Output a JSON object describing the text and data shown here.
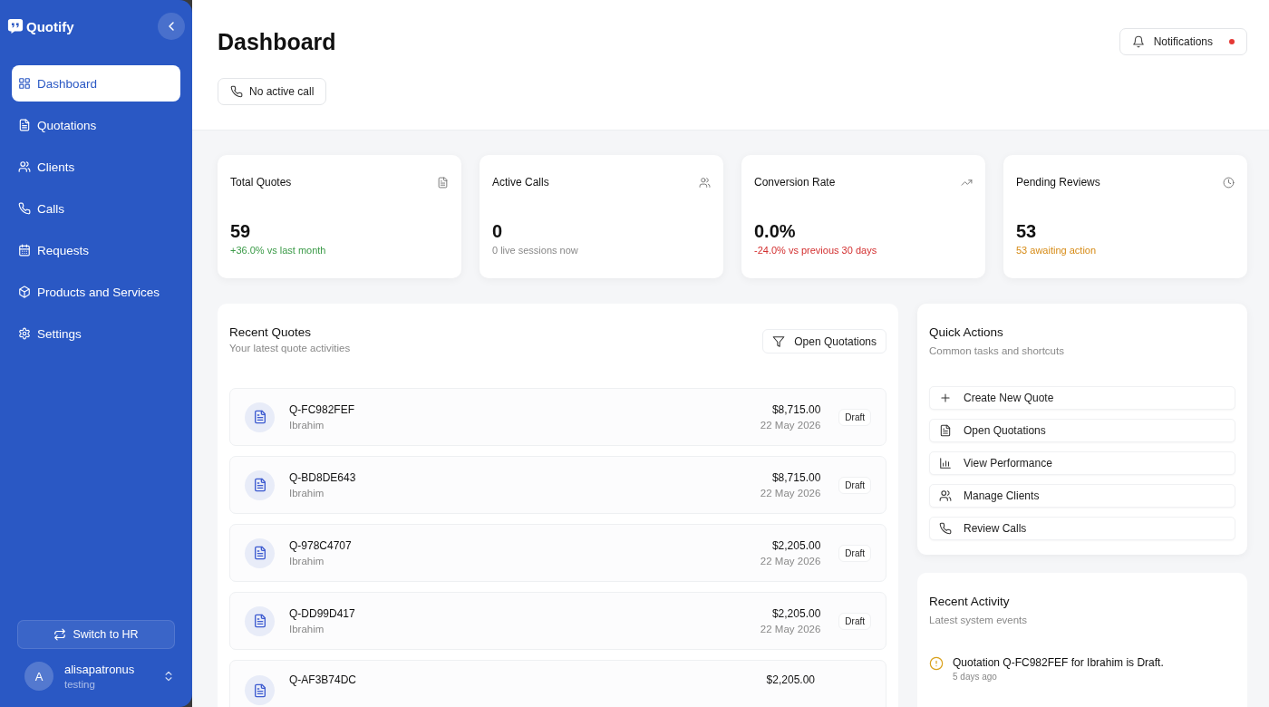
{
  "sidebar": {
    "brand": "Quotify",
    "items": [
      {
        "label": "Dashboard",
        "selected": true
      },
      {
        "label": "Quotations",
        "selected": false
      },
      {
        "label": "Clients",
        "selected": false
      },
      {
        "label": "Calls",
        "selected": false
      },
      {
        "label": "Requests",
        "selected": false
      },
      {
        "label": "Products and Services",
        "selected": false
      },
      {
        "label": "Settings",
        "selected": false
      }
    ],
    "switch_button": "Switch to HR",
    "user": {
      "initial": "A",
      "name": "alisapatronus",
      "role": "testing"
    }
  },
  "header": {
    "title": "Dashboard",
    "call_status": "No active call",
    "notifications": {
      "label": "Notifications",
      "unread": true
    }
  },
  "stats": [
    {
      "title": "Total Quotes",
      "value": "59",
      "note": "+36.0% vs last month",
      "color": "#3a9a47"
    },
    {
      "title": "Active Calls",
      "value": "0",
      "note": "0 live sessions now",
      "color": "#888888"
    },
    {
      "title": "Conversion Rate",
      "value": "0.0%",
      "note": "-24.0% vs previous 30 days",
      "color": "#d32f2f"
    },
    {
      "title": "Pending Reviews",
      "value": "53",
      "note": "53 awaiting action",
      "color": "#d68a14"
    }
  ],
  "recent_quotes": {
    "title": "Recent Quotes",
    "subtitle": "Your latest quote activities",
    "button": "Open Quotations",
    "rows": [
      {
        "id": "Q-FC982FEF",
        "client": "Ibrahim",
        "amount": "$8,715.00",
        "date": "22 May 2026",
        "status": "Draft"
      },
      {
        "id": "Q-BD8DE643",
        "client": "Ibrahim",
        "amount": "$8,715.00",
        "date": "22 May 2026",
        "status": "Draft"
      },
      {
        "id": "Q-978C4707",
        "client": "Ibrahim",
        "amount": "$2,205.00",
        "date": "22 May 2026",
        "status": "Draft"
      },
      {
        "id": "Q-DD99D417",
        "client": "Ibrahim",
        "amount": "$2,205.00",
        "date": "22 May 2026",
        "status": "Draft"
      },
      {
        "id": "Q-AF3B74DC",
        "amount": "$2,205.00"
      }
    ]
  },
  "quick_actions": {
    "title": "Quick Actions",
    "subtitle": "Common tasks and shortcuts",
    "items": [
      "Create New Quote",
      "Open Quotations",
      "View Performance",
      "Manage Clients",
      "Review Calls"
    ]
  },
  "recent_activity": {
    "title": "Recent Activity",
    "subtitle": "Latest system events",
    "items": [
      {
        "text": "Quotation Q-FC982FEF for Ibrahim is Draft.",
        "time": "5 days ago"
      }
    ]
  }
}
